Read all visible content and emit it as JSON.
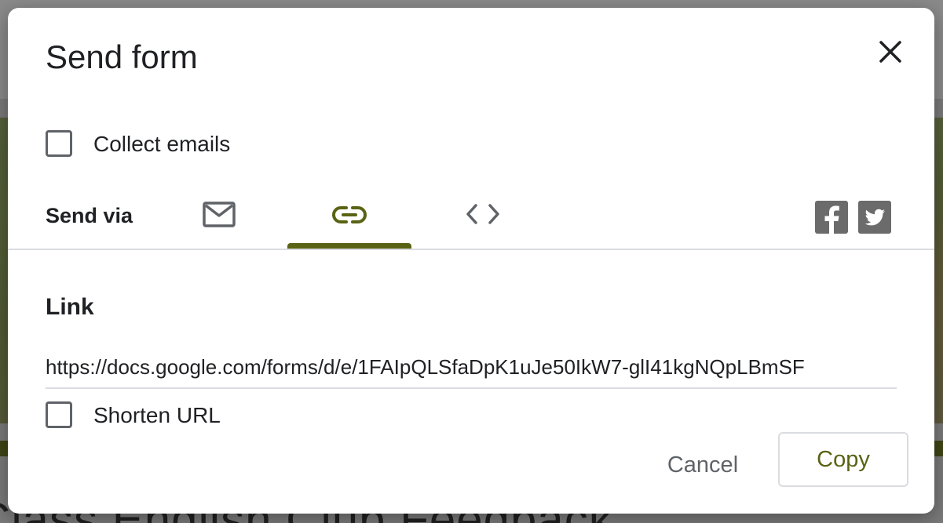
{
  "dialog": {
    "title": "Send form",
    "close_icon": "close-icon"
  },
  "collect_emails": {
    "label": "Collect emails",
    "checked": false
  },
  "send_via": {
    "label": "Send via",
    "tabs": [
      {
        "name": "email",
        "icon": "mail-icon",
        "selected": false
      },
      {
        "name": "link",
        "icon": "link-icon",
        "selected": true
      },
      {
        "name": "embed",
        "icon": "code-icon",
        "selected": false
      }
    ],
    "share": [
      {
        "name": "facebook",
        "icon": "facebook-icon"
      },
      {
        "name": "twitter",
        "icon": "twitter-icon"
      }
    ]
  },
  "link_section": {
    "title": "Link",
    "url": "https://docs.google.com/forms/d/e/1FAIpQLSfaDpK1uJe50IkW7-glI41kgNQpLBmSF"
  },
  "shorten_url": {
    "label": "Shorten URL",
    "checked": false
  },
  "actions": {
    "cancel_label": "Cancel",
    "copy_label": "Copy"
  },
  "background": {
    "page_title": "Class English Club Feedback"
  },
  "colors": {
    "accent": "#5a6314",
    "text_primary": "#202124",
    "text_secondary": "#5f6368",
    "divider": "#dadce0",
    "social_icon_bg": "#6b6b6b"
  }
}
